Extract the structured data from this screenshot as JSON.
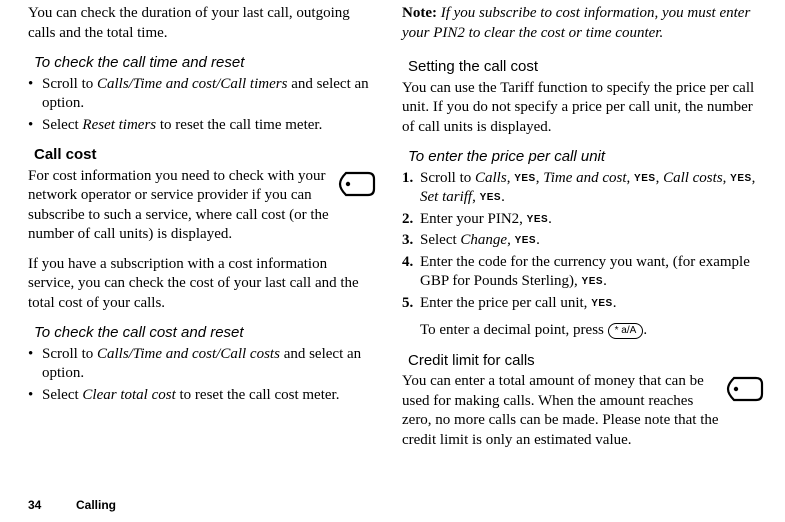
{
  "left": {
    "intro": "You can check the duration of your last call, outgoing calls and the total time.",
    "h1": "To check the call time and reset",
    "b1a": "Scroll to ",
    "b1path": "Calls/Time and cost/Call timers",
    "b1b": " and select an option.",
    "b2a": "Select ",
    "b2i": "Reset timers",
    "b2b": " to reset the call time meter.",
    "h2": "Call cost",
    "p2": "For cost information you need to check with your network operator or service provider if you can subscribe to such a service, where call cost (or the number of call units) is displayed.",
    "p3": "If you have a subscription with a cost information service, you can check the cost of your last call and the total cost of your calls.",
    "h3": "To check the call cost and reset",
    "c1a": "Scroll to ",
    "c1path": "Calls/Time and cost/Call costs",
    "c1b": " and select an option.",
    "c2a": "Select ",
    "c2i": "Clear total cost",
    "c2b": " to reset the call cost meter."
  },
  "right": {
    "noteLabel": "Note:",
    "note": " If you subscribe to cost information, you must enter your PIN2 to clear the cost or time counter.",
    "h1": "Setting the call cost",
    "p1": "You can use the Tariff function to specify the price per call unit. If you do not specify a price per call unit, the number of call units is displayed.",
    "h2": "To enter the price per call unit",
    "s1a": "Scroll to ",
    "s1_calls": "Calls",
    "s1_time": "Time and cost",
    "s1_costs": "Call costs",
    "s1_set": "Set tariff",
    "comma": ", ",
    "period": ".",
    "yes": "YES",
    "s2a": "Enter your PIN2, ",
    "s3a": "Select ",
    "s3i": "Change",
    "s4": "Enter the code for the currency you want, (for example GBP for Pounds Sterling), ",
    "s5": "Enter the price per call unit, ",
    "s5b": "To enter a decimal point, press ",
    "key": "* a/A",
    "h3": "Credit limit for calls",
    "p3": "You can enter a total amount of money that can be used for making calls. When the amount reaches zero, no more calls can be made. Please note that the credit limit is only an estimated value."
  },
  "footer": {
    "pageNum": "34",
    "section": "Calling"
  }
}
